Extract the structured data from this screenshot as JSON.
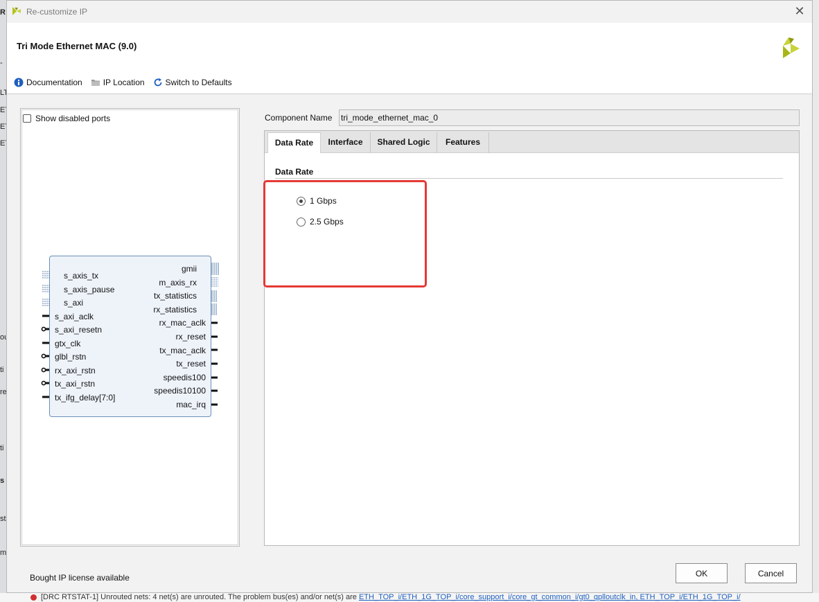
{
  "background": {
    "left_fragments": [
      "R",
      "-",
      "LT",
      "ET",
      "ET",
      "ET",
      "ou",
      "ti",
      "re",
      "ti",
      "s",
      "str",
      "m"
    ],
    "status_message": "[DRC RTSTAT-1] Unrouted nets: 4 net(s) are unrouted. The problem bus(es) and/or net(s) are ",
    "status_link": "ETH_TOP_i/ETH_1G_TOP_i/core_support_i/core_gt_common_i/gt0_qplloutclk_in, ETH_TOP_i/ETH_1G_TOP_i/"
  },
  "window": {
    "title": "Re-customize IP",
    "close_glyph": "✕"
  },
  "header": {
    "ip_title": "Tri Mode Ethernet MAC (9.0)"
  },
  "toolbar": {
    "documentation": "Documentation",
    "ip_location": "IP Location",
    "switch_defaults": "Switch to Defaults"
  },
  "left_panel": {
    "show_disabled_ports": "Show disabled ports",
    "show_disabled_checked": false,
    "left_ports": [
      "s_axis_tx",
      "s_axis_pause",
      "s_axi",
      "s_axi_aclk",
      "s_axi_resetn",
      "gtx_clk",
      "glbl_rstn",
      "rx_axi_rstn",
      "tx_axi_rstn",
      "tx_ifg_delay[7:0]"
    ],
    "right_ports": [
      "gmii",
      "m_axis_rx",
      "tx_statistics",
      "rx_statistics",
      "rx_mac_aclk",
      "rx_reset",
      "tx_mac_aclk",
      "tx_reset",
      "speedis100",
      "speedis10100",
      "mac_irq"
    ]
  },
  "component": {
    "label": "Component Name",
    "value": "tri_mode_ethernet_mac_0"
  },
  "tabs": [
    {
      "label": "Data Rate",
      "active": true
    },
    {
      "label": "Interface",
      "active": false
    },
    {
      "label": "Shared Logic",
      "active": false
    },
    {
      "label": "Features",
      "active": false
    }
  ],
  "data_rate": {
    "section_title": "Data Rate",
    "options": [
      {
        "label": "1 Gbps",
        "selected": true
      },
      {
        "label": "2.5 Gbps",
        "selected": false
      }
    ]
  },
  "footer": {
    "license": "Bought IP license available",
    "ok": "OK",
    "cancel": "Cancel"
  },
  "colors": {
    "highlight_border": "#e53935",
    "brand_logo": "#b5c21a",
    "info_icon": "#1f5fbf",
    "block_fill": "#eef3fa",
    "block_border": "#6a8fb6"
  }
}
